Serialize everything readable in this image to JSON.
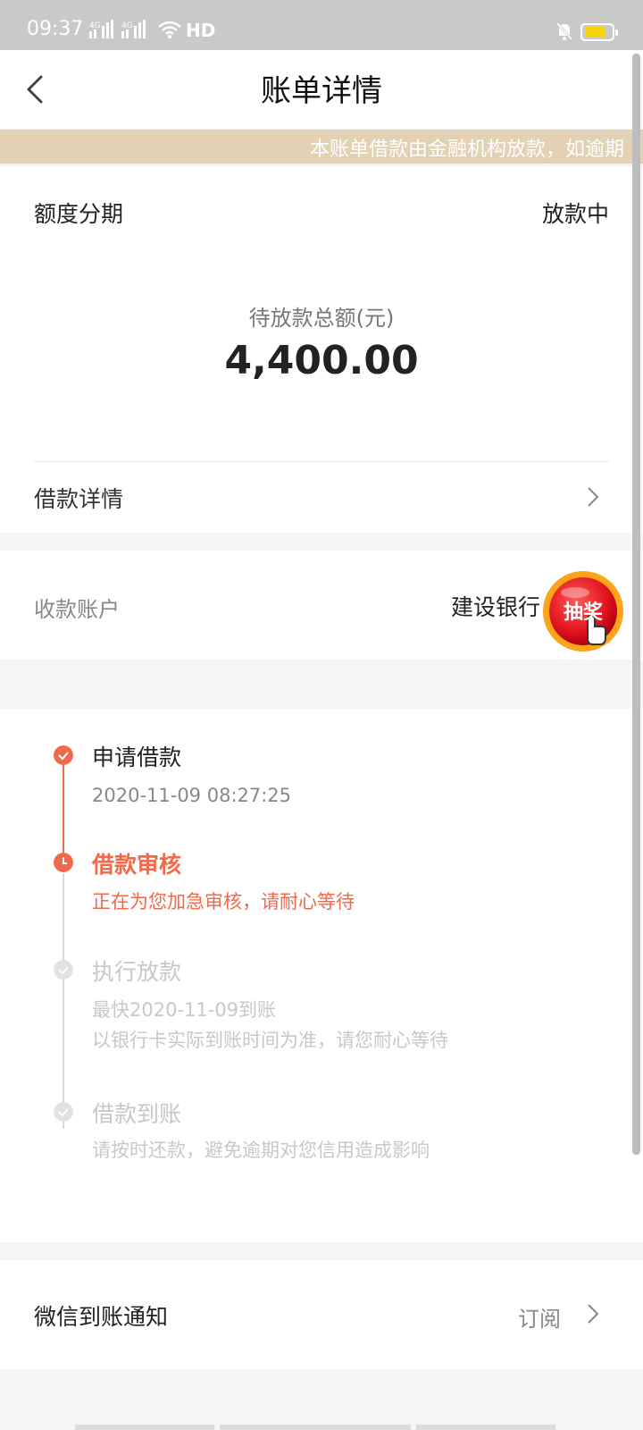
{
  "status_bar": {
    "time": "09:37",
    "network_1": "4G",
    "network_2": "4G",
    "hd": "HD",
    "battery_level": 0.6
  },
  "header": {
    "title": "账单详情"
  },
  "notice": {
    "text": "本账单借款由金融机构放款，如逾期"
  },
  "loan": {
    "product": "额度分期",
    "status": "放款中",
    "amount_label": "待放款总额(元)",
    "amount": "4,400.00",
    "detail_label": "借款详情"
  },
  "account": {
    "label": "收款账户",
    "value": "建设银行"
  },
  "lottery": {
    "label": "抽奖"
  },
  "timeline": [
    {
      "title": "申请借款",
      "desc": [
        "2020-11-09 08:27:25"
      ],
      "state": "done"
    },
    {
      "title": "借款审核",
      "desc": [
        "正在为您加急审核，请耐心等待"
      ],
      "state": "current"
    },
    {
      "title": "执行放款",
      "desc": [
        "最快2020-11-09到账",
        "以银行卡实际到账时间为准，请您耐心等待"
      ],
      "state": "pending"
    },
    {
      "title": "借款到账",
      "desc": [
        "请按时还款，避免逾期对您信用造成影响"
      ],
      "state": "pending"
    }
  ],
  "wechat": {
    "label": "微信到账通知",
    "action": "订阅"
  },
  "colors": {
    "accent": "#ef6a4a",
    "pending": "#c8c8c8",
    "notice_bg": "#e2d2b3",
    "status_bar": "#c9c9c9"
  }
}
